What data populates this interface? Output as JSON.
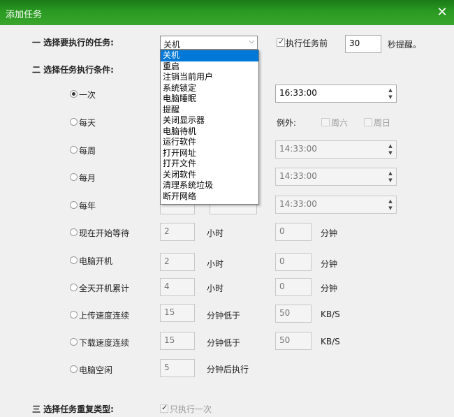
{
  "window": {
    "title": "添加任务"
  },
  "section1": {
    "label": "一 选择要执行的任务:",
    "selected": "关机",
    "options": [
      "关机",
      "重启",
      "注销当前用户",
      "系统锁定",
      "电脑睡眠",
      "提醒",
      "关闭显示器",
      "电脑待机",
      "运行软件",
      "打开网址",
      "打开文件",
      "关闭软件",
      "清理系统垃圾",
      "断开网络"
    ],
    "remind_checkbox_label": "执行任务前",
    "remind_value": "30",
    "remind_suffix": "秒提醒。"
  },
  "section2": {
    "label": "二 选择任务执行条件:",
    "conditions": {
      "once": {
        "label": "一次",
        "time": "16:33:00"
      },
      "daily": {
        "label": "每天",
        "exception_label": "例外:",
        "sat": "周六",
        "sun": "周日"
      },
      "weekly": {
        "label": "每周",
        "time": "14:33:00"
      },
      "monthly": {
        "label": "每月",
        "time": "14:33:00"
      },
      "yearly": {
        "label": "每年",
        "time": "14:33:00"
      },
      "wait": {
        "label": "现在开始等待",
        "hours": "2",
        "hours_unit": "小时",
        "minutes": "0",
        "minutes_unit": "分钟"
      },
      "boot": {
        "label": "电脑开机",
        "hours": "2",
        "hours_unit": "小时",
        "minutes": "0",
        "minutes_unit": "分钟"
      },
      "uptime": {
        "label": "全天开机累计",
        "hours": "4",
        "hours_unit": "小时",
        "minutes": "0",
        "minutes_unit": "分钟"
      },
      "upload": {
        "label": "上传速度连续",
        "minutes": "15",
        "minutes_unit": "分钟低于",
        "speed": "50",
        "speed_unit": "KB/S"
      },
      "download": {
        "label": "下载速度连续",
        "minutes": "15",
        "minutes_unit": "分钟低于",
        "speed": "50",
        "speed_unit": "KB/S"
      },
      "idle": {
        "label": "电脑空闲",
        "minutes": "5",
        "minutes_unit": "分钟后执行"
      }
    }
  },
  "section3": {
    "label": "三 选择任务重复类型:",
    "once_only_label": "只执行一次"
  }
}
